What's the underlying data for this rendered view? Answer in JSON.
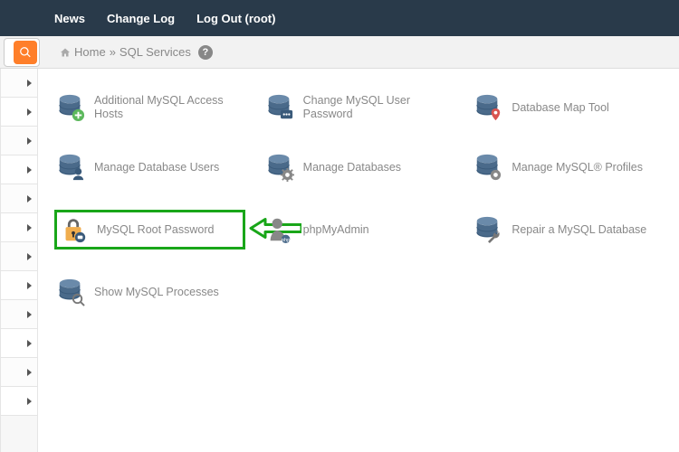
{
  "topnav": {
    "news": "News",
    "changelog": "Change Log",
    "logout": "Log Out (root)"
  },
  "breadcrumb": {
    "home": "Home",
    "sep": "»",
    "current": "SQL Services"
  },
  "items": [
    {
      "label": "Additional MySQL Access Hosts",
      "icon": "db-add"
    },
    {
      "label": "Change MySQL User Password",
      "icon": "db-pass"
    },
    {
      "label": "Database Map Tool",
      "icon": "db-map"
    },
    {
      "label": "Manage Database Users",
      "icon": "db-users"
    },
    {
      "label": "Manage Databases",
      "icon": "db-gear"
    },
    {
      "label": "Manage MySQL® Profiles",
      "icon": "db-profile"
    },
    {
      "label": "MySQL Root Password",
      "icon": "lock"
    },
    {
      "label": "phpMyAdmin",
      "icon": "pma"
    },
    {
      "label": "Repair a MySQL Database",
      "icon": "db-wrench"
    },
    {
      "label": "Show MySQL Processes",
      "icon": "db-search"
    }
  ],
  "highlight_index": 6
}
